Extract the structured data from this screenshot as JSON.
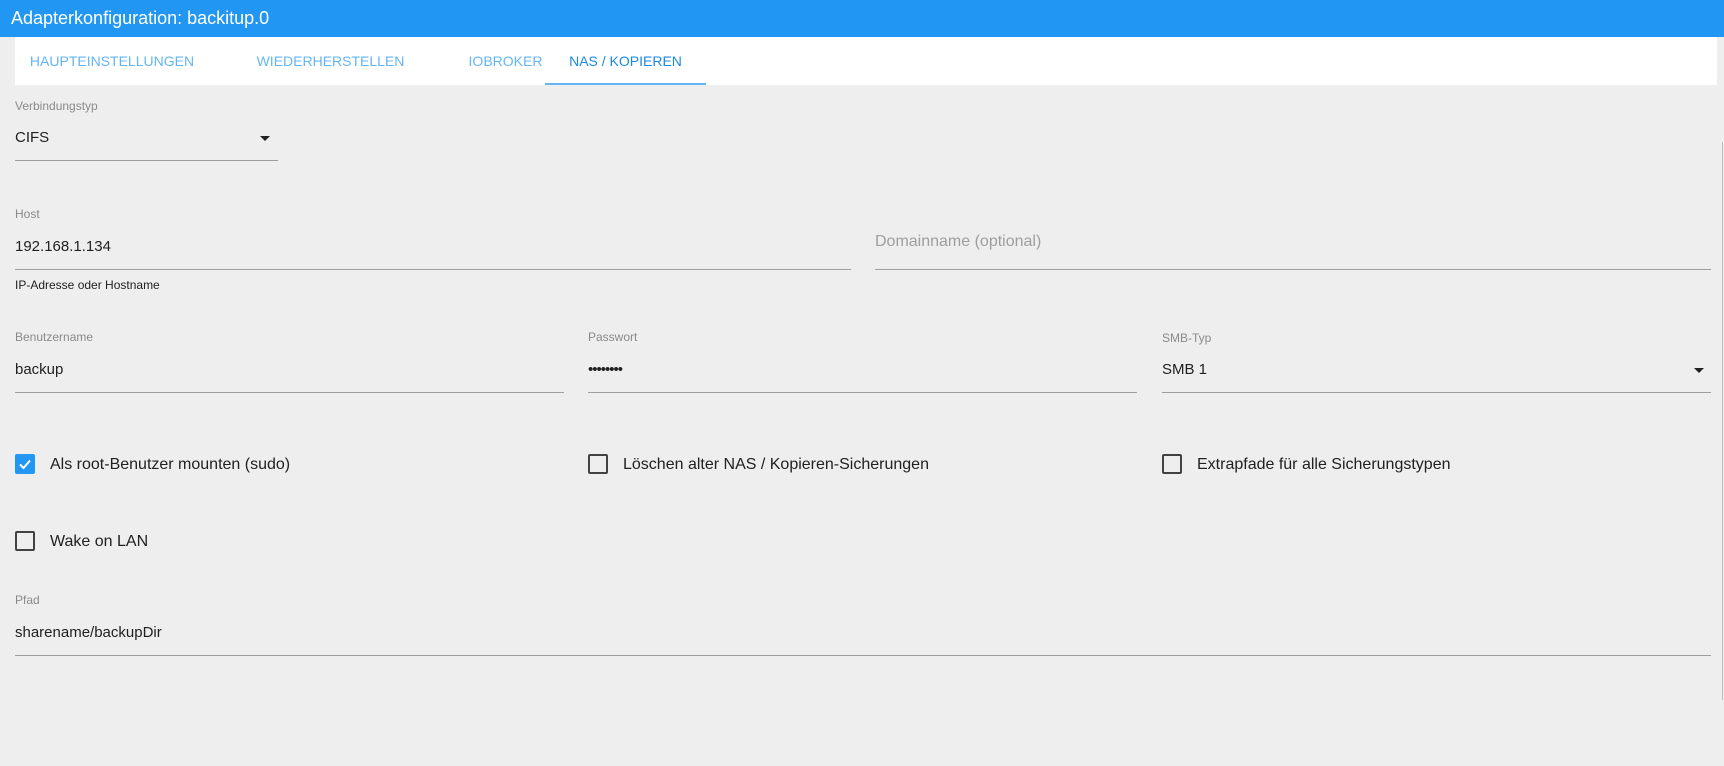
{
  "window": {
    "title": "Adapterkonfiguration: backitup.0"
  },
  "tabs": [
    {
      "label": "HAUPTEINSTELLUNGEN",
      "active": false
    },
    {
      "label": "WIEDERHERSTELLEN",
      "active": false
    },
    {
      "label": "IOBROKER",
      "active": false
    },
    {
      "label": "NAS / KOPIEREN",
      "active": true
    }
  ],
  "form": {
    "connection_type": {
      "label": "Verbindungstyp",
      "value": "CIFS"
    },
    "host": {
      "label": "Host",
      "value": "192.168.1.134",
      "helper": "IP-Adresse oder Hostname"
    },
    "domain": {
      "placeholder": "Domainname (optional)"
    },
    "username": {
      "label": "Benutzername",
      "value": "backup"
    },
    "password": {
      "label": "Passwort",
      "value": "••••••••"
    },
    "smb_type": {
      "label": "SMB-Typ",
      "value": "SMB 1"
    },
    "checkboxes": {
      "mount_root": {
        "label": "Als root-Benutzer mounten (sudo)",
        "checked": true
      },
      "delete_old": {
        "label": "Löschen alter NAS / Kopieren-Sicherungen",
        "checked": false
      },
      "extra_paths": {
        "label": "Extrapfade für alle Sicherungstypen",
        "checked": false
      },
      "wake_on_lan": {
        "label": "Wake on LAN",
        "checked": false
      }
    },
    "path": {
      "label": "Pfad",
      "value": "sharename/backupDir"
    }
  },
  "colors": {
    "accent": "#2196f3",
    "tab_text": "#64b5f6",
    "background": "#eeeeee"
  }
}
